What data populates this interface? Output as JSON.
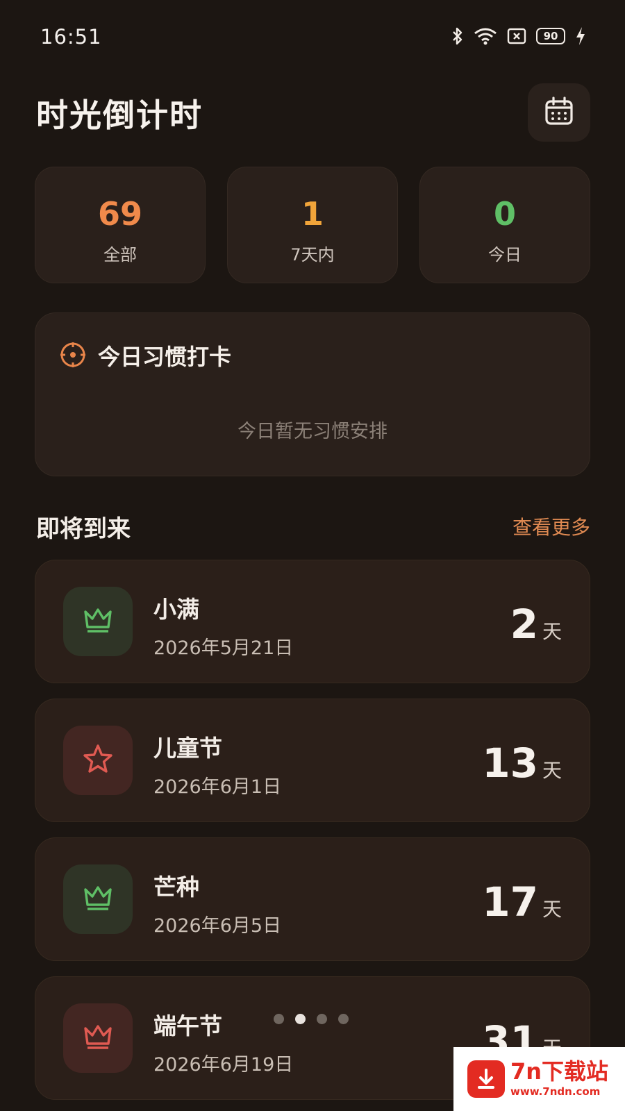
{
  "status_bar": {
    "time": "16:51",
    "battery": "90",
    "icons": [
      "bluetooth-icon",
      "wifi-icon",
      "sim-off-icon",
      "battery-icon",
      "charging-icon"
    ]
  },
  "header": {
    "title": "时光倒计时",
    "calendar_icon": "calendar-icon"
  },
  "stats": [
    {
      "value": "69",
      "label": "全部",
      "color": "#f08a4b"
    },
    {
      "value": "1",
      "label": "7天内",
      "color": "#f0a43a"
    },
    {
      "value": "0",
      "label": "今日",
      "color": "#5fbf66"
    }
  ],
  "habit": {
    "title": "今日习惯打卡",
    "empty_text": "今日暂无习惯安排",
    "icon": "target-icon",
    "icon_color": "#e9854a"
  },
  "upcoming": {
    "title": "即将到来",
    "more_label": "查看更多",
    "day_unit": "天",
    "events": [
      {
        "name": "小满",
        "date": "2026年5月21日",
        "days": "2",
        "icon": "crown-icon",
        "icon_color": "#5fbf66",
        "icon_bg": "#2f3426"
      },
      {
        "name": "儿童节",
        "date": "2026年6月1日",
        "days": "13",
        "icon": "star-icon",
        "icon_color": "#e05a52",
        "icon_bg": "#432622"
      },
      {
        "name": "芒种",
        "date": "2026年6月5日",
        "days": "17",
        "icon": "crown-icon",
        "icon_color": "#5fbf66",
        "icon_bg": "#2f3426"
      },
      {
        "name": "端午节",
        "date": "2026年6月19日",
        "days": "31",
        "icon": "crown-icon",
        "icon_color": "#e05a52",
        "icon_bg": "#432622"
      }
    ]
  },
  "pagination": {
    "count": 4,
    "active": 1
  },
  "watermark": {
    "title": "7n下载站",
    "url": "www.7ndn.com"
  }
}
